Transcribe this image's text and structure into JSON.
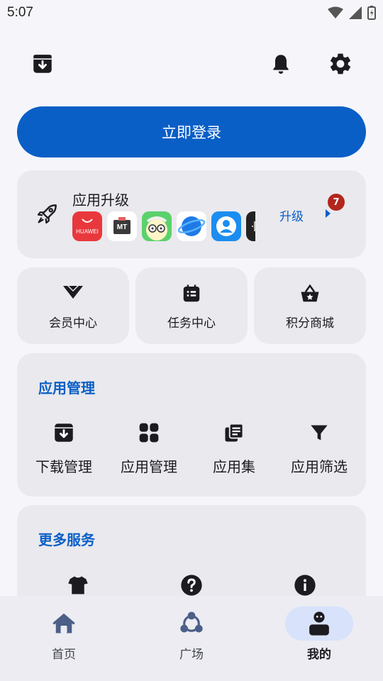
{
  "status_bar": {
    "time": "5:07"
  },
  "login": {
    "label": "立即登录"
  },
  "upgrade": {
    "title": "应用升级",
    "action": "升级",
    "count": "7",
    "apps": [
      {
        "name": "huawei-appgallery-icon",
        "label": "HUAWEI"
      },
      {
        "name": "mt-manager-icon",
        "label": "MT"
      },
      {
        "name": "cartoon-app-icon",
        "label": ""
      },
      {
        "name": "browser-globe-icon",
        "label": ""
      },
      {
        "name": "account-app-icon",
        "label": ""
      },
      {
        "name": "audio-app-icon",
        "label": ""
      }
    ]
  },
  "quick_links": [
    {
      "label": "会员中心",
      "icon": "vip-diamond-icon"
    },
    {
      "label": "任务中心",
      "icon": "task-list-icon"
    },
    {
      "label": "积分商城",
      "icon": "shopping-basket-icon"
    }
  ],
  "app_management": {
    "title": "应用管理",
    "items": [
      {
        "label": "下载管理",
        "icon": "download-box-icon"
      },
      {
        "label": "应用管理",
        "icon": "apps-grid-icon"
      },
      {
        "label": "应用集",
        "icon": "collection-icon"
      },
      {
        "label": "应用筛选",
        "icon": "filter-icon"
      }
    ]
  },
  "more_services": {
    "title": "更多服务",
    "items": [
      {
        "label": "",
        "icon": "shirt-icon"
      },
      {
        "label": "",
        "icon": "help-icon"
      },
      {
        "label": "",
        "icon": "info-icon"
      }
    ]
  },
  "bottom_nav": [
    {
      "label": "首页",
      "icon": "home-icon"
    },
    {
      "label": "广场",
      "icon": "community-icon"
    },
    {
      "label": "我的",
      "icon": "profile-icon",
      "active": true
    }
  ],
  "colors": {
    "accent": "#0a5fc6",
    "card": "#e9e9ee",
    "badge": "#b3261e"
  }
}
